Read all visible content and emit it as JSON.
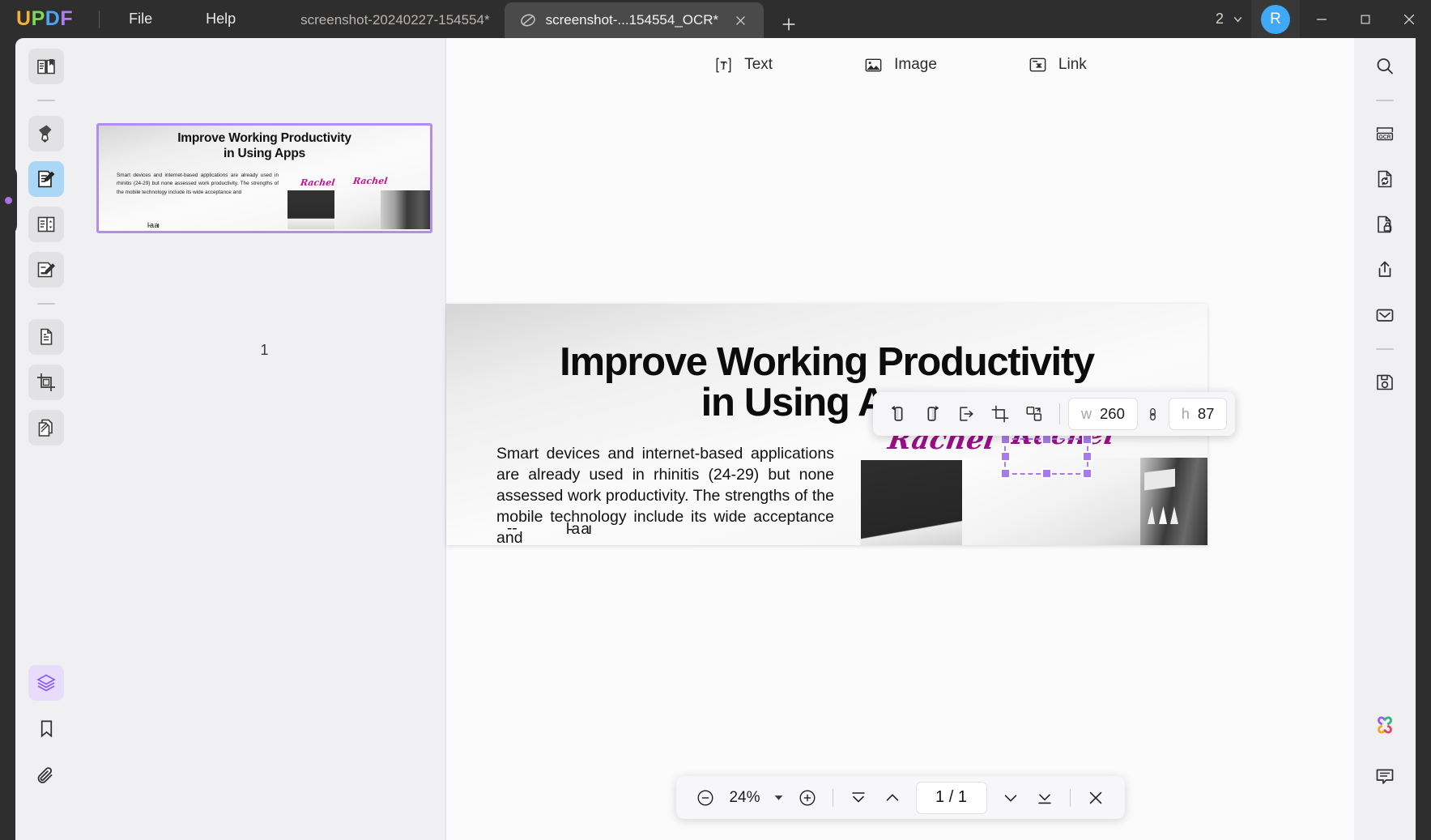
{
  "app": {
    "name": "UPDF",
    "logo_letters": [
      "U",
      "P",
      "D",
      "F"
    ],
    "accent_purple": "#a77bea",
    "accent_blue": "#3fa9f5",
    "titlebar_bg": "#2e2e2e"
  },
  "menu": {
    "file": "File",
    "help": "Help"
  },
  "tabs": [
    {
      "title": "screenshot-20240227-154554*",
      "active": false
    },
    {
      "title": "screenshot-...154554_OCR*",
      "active": true
    }
  ],
  "tabbar": {
    "new_tab_label": "+",
    "close_label": "×"
  },
  "account": {
    "count": "2",
    "avatar_initial": "R"
  },
  "window_controls": {
    "minimize": "—",
    "maximize": "□",
    "close": "✕"
  },
  "left_rail": {
    "items": [
      {
        "name": "reader-mode",
        "icon": "book-icon",
        "state": "normal"
      },
      {
        "name": "annotate",
        "icon": "highlighter-icon",
        "state": "normal"
      },
      {
        "name": "edit-pdf",
        "icon": "edit-document-icon",
        "state": "active-blue"
      },
      {
        "name": "organize-pages",
        "icon": "page-organize-icon",
        "state": "normal"
      },
      {
        "name": "fill-and-sign",
        "icon": "sign-document-icon",
        "state": "normal"
      },
      {
        "name": "page-tools",
        "icon": "document-copy-icon",
        "state": "normal"
      },
      {
        "name": "crop-pages",
        "icon": "crop-icon",
        "state": "normal"
      },
      {
        "name": "batch-process",
        "icon": "stack-pages-icon",
        "state": "normal"
      }
    ],
    "bottom_items": [
      {
        "name": "layers",
        "icon": "layers-icon",
        "state": "active-purple"
      },
      {
        "name": "bookmarks",
        "icon": "bookmark-icon",
        "state": "plain"
      },
      {
        "name": "attachments",
        "icon": "paperclip-icon",
        "state": "plain"
      }
    ]
  },
  "right_rail": {
    "items": [
      {
        "name": "search",
        "icon": "search-icon"
      },
      {
        "name": "ocr",
        "icon": "ocr-icon"
      },
      {
        "name": "convert",
        "icon": "convert-document-icon"
      },
      {
        "name": "protect",
        "icon": "lock-document-icon"
      },
      {
        "name": "share",
        "icon": "share-icon"
      },
      {
        "name": "email",
        "icon": "email-icon"
      },
      {
        "name": "save",
        "icon": "save-disk-icon"
      }
    ],
    "bottom_items": [
      {
        "name": "updf-ai",
        "icon": "ai-flower-icon"
      },
      {
        "name": "comments",
        "icon": "comment-icon"
      }
    ]
  },
  "edit_toolbar": {
    "tools": [
      {
        "label": "Text",
        "icon": "text-box-icon"
      },
      {
        "label": "Image",
        "icon": "image-icon"
      },
      {
        "label": "Link",
        "icon": "link-icon"
      }
    ]
  },
  "thumbnails": {
    "pages": [
      {
        "number": "1",
        "selected": true
      }
    ]
  },
  "document": {
    "title_line1": "Improve Working Productivity",
    "title_line2": "in Using Apps",
    "body": "Smart devices and internet-based applications are already used in rhinitis (24-29) but none assessed work productivity. The strengths of the mobile technology include its wide acceptance and",
    "artifact_text": "l-a aı",
    "stray_marks": "--",
    "signature_left": "Rachel",
    "signature_right": "Rachel",
    "signature_color": "#9c0f86"
  },
  "image_toolbar": {
    "buttons": [
      {
        "name": "rotate-left",
        "icon": "rotate-left-icon"
      },
      {
        "name": "rotate-right",
        "icon": "rotate-right-icon"
      },
      {
        "name": "extract-image",
        "icon": "extract-icon"
      },
      {
        "name": "crop-image",
        "icon": "crop-icon"
      },
      {
        "name": "replace-image",
        "icon": "replace-icon"
      }
    ],
    "width_label": "w",
    "width_value": "260",
    "height_label": "h",
    "height_value": "87",
    "aspect_lock_icon": "link-aspect-icon"
  },
  "zoom_toolbar": {
    "zoom_out_icon": "minus-circle-icon",
    "zoom_level": "24%",
    "dropdown_icon": "caret-down-icon",
    "zoom_in_icon": "plus-circle-icon",
    "first_page_icon": "first-page-icon",
    "prev_page_icon": "prev-page-icon",
    "page_indicator": "1 / 1",
    "next_page_icon": "next-page-icon",
    "last_page_icon": "last-page-icon",
    "close_icon": "close-icon"
  }
}
